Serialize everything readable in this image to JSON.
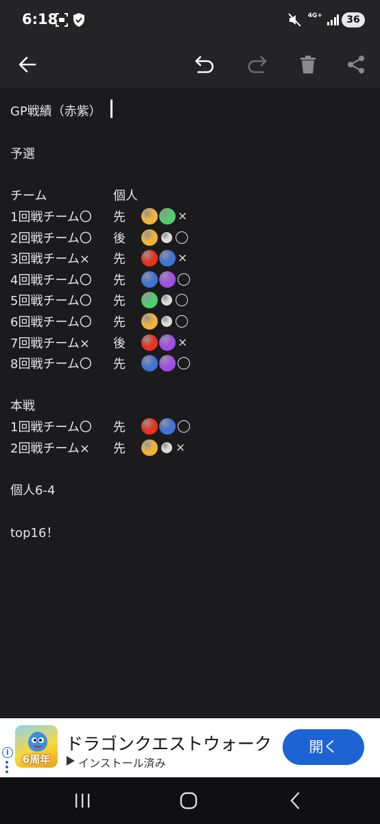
{
  "status_bar": {
    "time": "6:18",
    "network": "4G+",
    "battery": "36"
  },
  "toolbar": {
    "back_icon": "arrow-left-icon",
    "undo_icon": "undo-icon",
    "redo_icon": "redo-icon",
    "delete_icon": "trash-icon",
    "share_icon": "share-icon"
  },
  "note": {
    "title": "GP戦績（赤紫）",
    "section_qualifier": "予選",
    "header_team": "チーム",
    "header_individual": "個人",
    "qualifier_rows": [
      {
        "team": "1回戦チーム〇",
        "order": "先",
        "balls": [
          "orange",
          "green"
        ],
        "result": "×"
      },
      {
        "team": "2回戦チーム〇",
        "order": "後",
        "balls": [
          "orange",
          "white"
        ],
        "result": "〇"
      },
      {
        "team": "3回戦チーム×",
        "order": "先",
        "balls": [
          "red",
          "blue"
        ],
        "result": "×"
      },
      {
        "team": "4回戦チーム〇",
        "order": "先",
        "balls": [
          "blue",
          "purple"
        ],
        "result": "〇"
      },
      {
        "team": "5回戦チーム〇",
        "order": "先",
        "balls": [
          "green",
          "white"
        ],
        "result": "〇"
      },
      {
        "team": "6回戦チーム〇",
        "order": "先",
        "balls": [
          "orange",
          "white"
        ],
        "result": "〇"
      },
      {
        "team": "7回戦チーム×",
        "order": "後",
        "balls": [
          "red",
          "purple"
        ],
        "result": "×"
      },
      {
        "team": "8回戦チーム〇",
        "order": "先",
        "balls": [
          "blue",
          "purple"
        ],
        "result": "〇"
      }
    ],
    "section_main": "本戦",
    "main_rows": [
      {
        "team": "1回戦チーム〇",
        "order": "先",
        "balls": [
          "red",
          "blue"
        ],
        "result": "〇"
      },
      {
        "team": "2回戦チーム×",
        "order": "先",
        "balls": [
          "orange",
          "white"
        ],
        "result": "×"
      }
    ],
    "individual_record": "個人6-4",
    "final_result": "top16！"
  },
  "ad": {
    "title": "ドラゴンクエストウォーク",
    "subtitle": "インストール済み",
    "button": "開く",
    "icon_badge": "6周年",
    "info": "i"
  },
  "nav_bar": {
    "recents_icon": "recents-icon",
    "home_icon": "home-icon",
    "back_icon": "back-chevron-icon"
  },
  "colors": {
    "orange": "#f2b33a",
    "green": "#4fcf6e",
    "white": "#dcdcdc",
    "red": "#e8331f",
    "blue": "#3f73d6",
    "purple": "#a14de8",
    "ad_button": "#1d63d3",
    "background": "#1b1b1d",
    "toolbar": "#242426"
  }
}
